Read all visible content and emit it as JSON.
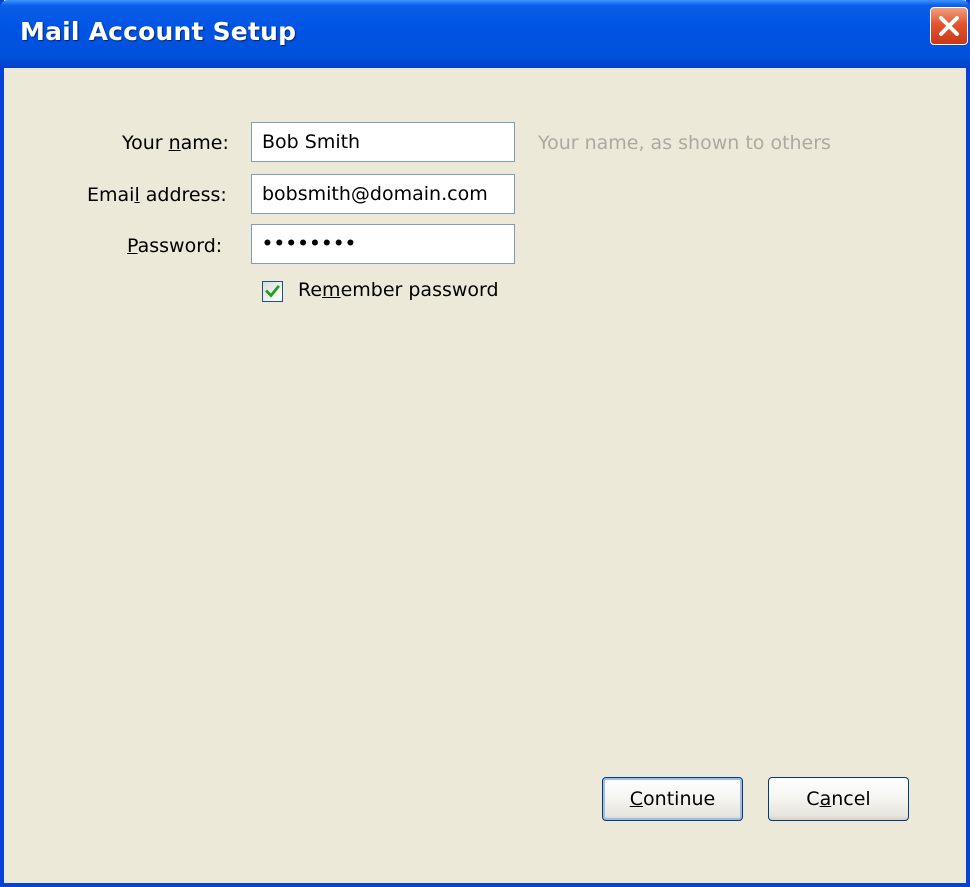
{
  "window": {
    "title": "Mail Account Setup"
  },
  "form": {
    "name_label_pre": "Your ",
    "name_label_accel": "n",
    "name_label_post": "ame:",
    "name_value": "Bob Smith",
    "name_hint": "Your name, as shown to others",
    "email_label_pre": "Emai",
    "email_label_accel": "l",
    "email_label_post": " address:",
    "email_value": "bobsmith@domain.com",
    "password_label_accel": "P",
    "password_label_post": "assword:",
    "password_value": "••••••••",
    "remember_label_pre": "Re",
    "remember_label_accel": "m",
    "remember_label_post": "ember password",
    "remember_checked": true
  },
  "buttons": {
    "continue_accel": "C",
    "continue_rest": "ontinue",
    "cancel_pre": "C",
    "cancel_accel": "a",
    "cancel_post": "ncel"
  },
  "colors": {
    "titlebar": "#0054e3",
    "window_bg": "#ece9d8",
    "close_button": "#e2542d",
    "checkmark": "#21a121",
    "hint_text": "#acaaa0"
  },
  "icons": {
    "close": "close-icon",
    "checkmark": "checkmark-icon"
  }
}
